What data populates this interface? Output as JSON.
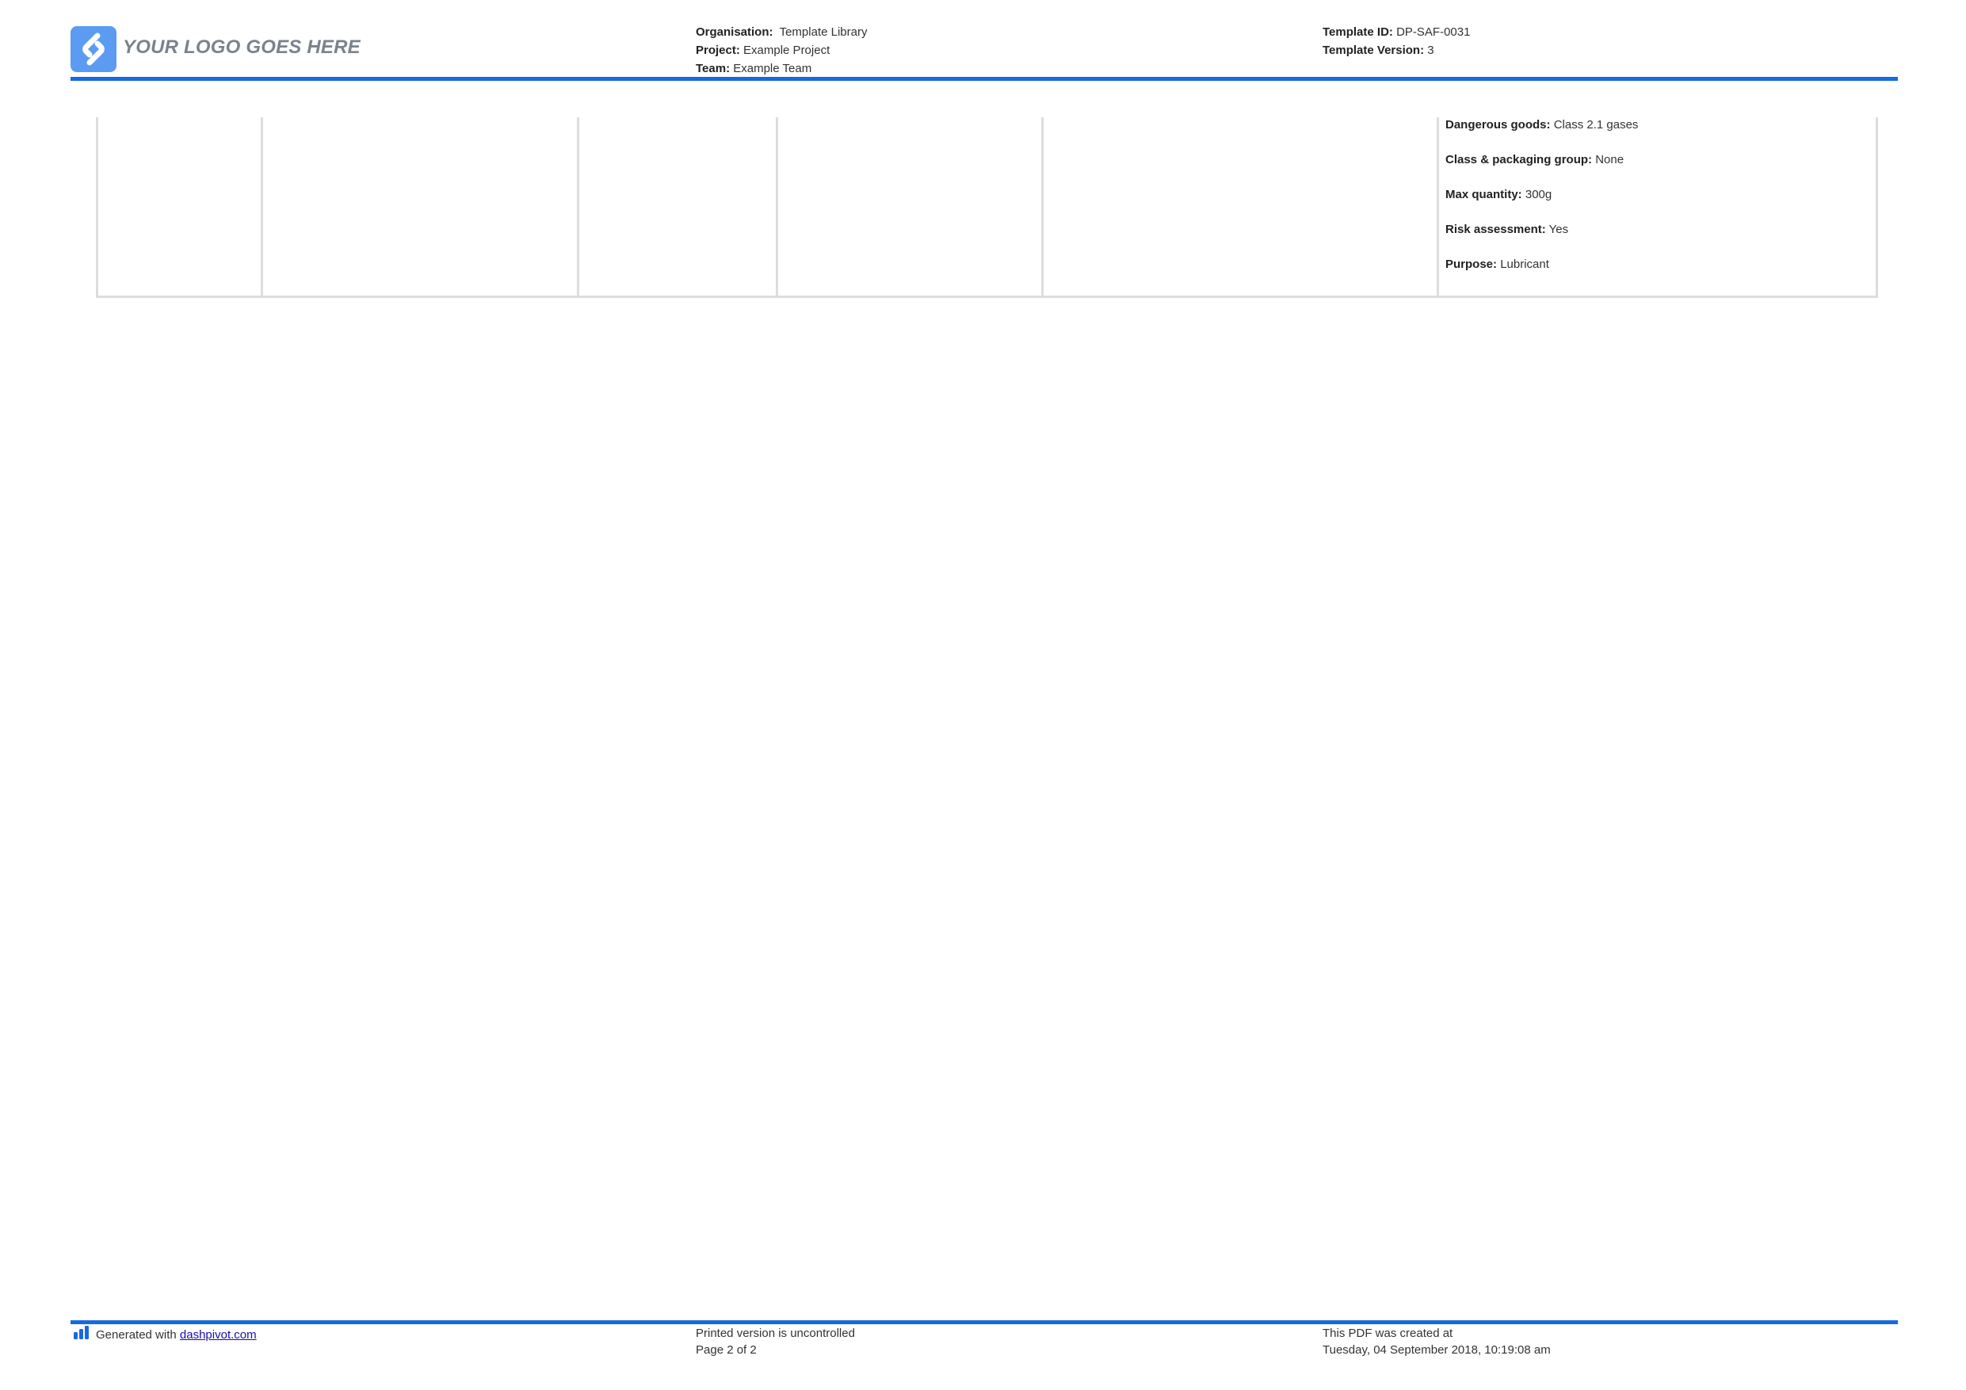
{
  "header": {
    "logo_text": "YOUR LOGO GOES HERE",
    "organisation_label": "Organisation:",
    "organisation_value": "Template Library",
    "project_label": "Project:",
    "project_value": "Example Project",
    "team_label": "Team:",
    "team_value": "Example Team",
    "template_id_label": "Template ID:",
    "template_id_value": "DP-SAF-0031",
    "template_version_label": "Template Version:",
    "template_version_value": "3"
  },
  "table": {
    "details": [
      {
        "label": "Dangerous goods:",
        "value": "Class 2.1 gases"
      },
      {
        "label": "Class & packaging group:",
        "value": "None"
      },
      {
        "label": "Max quantity:",
        "value": "300g"
      },
      {
        "label": "Risk assessment:",
        "value": "Yes"
      },
      {
        "label": "Purpose:",
        "value": "Lubricant"
      }
    ]
  },
  "footer": {
    "generated_prefix": "Generated with",
    "generated_link": "dashpivot.com",
    "printed_note": "Printed version is uncontrolled",
    "page_info": "Page 2 of 2",
    "created_label": "This PDF was created at",
    "created_value": "Tuesday, 04 September 2018, 10:19:08 am"
  },
  "colors": {
    "accent": "#1769e0",
    "logo_bg": "#5b9bf2",
    "border": "#dddddd"
  },
  "icons": {
    "logo": "logo-icon",
    "footer": "bar-chart-icon"
  }
}
